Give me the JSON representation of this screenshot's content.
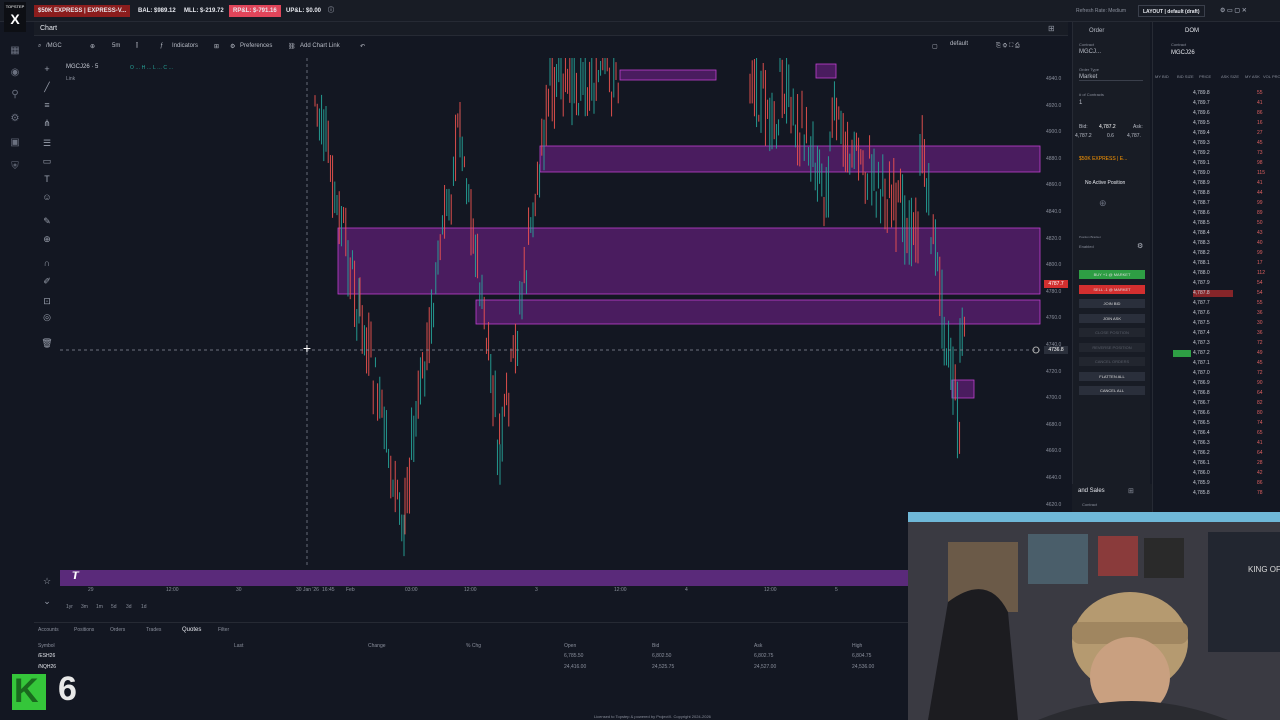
{
  "topbar": {
    "account": "$50K EXPRESS | EXPRESS-V...",
    "bal": "BAL: $989.12",
    "mll": "MLL: $-219.72",
    "rpl": "RP&L: $-791.16",
    "upl": "UP&L: $0.00",
    "refresh": "Refresh Rate: Medium",
    "layout": "LAYOUT | default (draft)"
  },
  "logo": "TOPSTEP",
  "chart_tab": "Chart",
  "toolbar": {
    "symbol": "/MGC",
    "interval": "5m",
    "indicators": "Indicators",
    "preferences": "Preferences",
    "add_chart_link": "Add Chart Link",
    "layout_name": "default",
    "position_bracket": "Position Bracket",
    "bracket_status": "Enabled"
  },
  "chart": {
    "symbol_line": "MGCJ26 · 5",
    "link": "Link",
    "crosshair_price": "4736.8",
    "last_price": "4787.7",
    "price_labels": [
      "4940.0",
      "4920.0",
      "4900.0",
      "4880.0",
      "4860.0",
      "4840.0",
      "4820.0",
      "4800.0",
      "4780.0",
      "4760.0",
      "4740.0",
      "4720.0",
      "4700.0",
      "4680.0",
      "4660.0",
      "4640.0",
      "4620.0"
    ],
    "time_labels": [
      "29",
      "12:00",
      "30",
      "30 Jan '26",
      "16:45",
      "Feb",
      "03:00",
      "12:00",
      "3",
      "12:00",
      "4",
      "12:00",
      "5"
    ],
    "ranges": [
      "1yr",
      "3m",
      "1m",
      "5d",
      "3d",
      "1d"
    ]
  },
  "bottom": {
    "tabs": [
      "Accounts",
      "Positions",
      "Orders",
      "Trades",
      "Quotes",
      "Filter"
    ],
    "active_tab": "Quotes",
    "headers": [
      "Symbol",
      "Last",
      "Change",
      "% Chg",
      "Open",
      "Bid",
      "Ask",
      "High"
    ],
    "rows": [
      [
        "/ESH26",
        "",
        "",
        "",
        "6,785.50",
        "6,802.50",
        "6,802.75",
        "6,804.75"
      ],
      [
        "/NQH26",
        "",
        "",
        "",
        "24,416.00",
        "24,525.75",
        "24,527.00",
        "24,536.00"
      ]
    ],
    "footer": "Licensed to Topstep & powered by ProjectX. Copyright 2024-2026"
  },
  "order": {
    "tabs": [
      "Order",
      "DOM"
    ],
    "contract_label": "Contract",
    "contract": "MGCJ...",
    "order_type_label": "Order Type",
    "order_type": "Market",
    "contracts_label": "# of Contracts",
    "contracts": "1",
    "bid_label": "Bid:",
    "bid": "4,787.2",
    "ask_label": "Ask:",
    "bid_val": "4,787.2",
    "spread": "0.6",
    "ask_val": "4,787.",
    "account": "$50K EXPRESS | E...",
    "no_position": "No Active Position",
    "bracket_label": "Position Bracket",
    "bracket": "Enabled",
    "buttons": [
      "BUY +1 @ MARKET",
      "SELL -1 @ MARKET",
      "JOIN BID",
      "JOIN ASK",
      "CLOSE POSITION",
      "REVERSE POSITION",
      "CANCEL ORDERS",
      "FLATTEN ALL",
      "CANCEL ALL"
    ],
    "ts_tab": "and Sales",
    "ts_contract": "Contract"
  },
  "dom": {
    "contract_label": "Contract",
    "contract": "MGCJ26",
    "headers": [
      "MY BID",
      "BID SIZE",
      "PRICE",
      "ASK SIZE",
      "MY ASK",
      "VOL PRO."
    ],
    "rows": [
      [
        "4,789.8",
        "55"
      ],
      [
        "4,789.7",
        "41"
      ],
      [
        "4,789.6",
        "86"
      ],
      [
        "4,789.5",
        "16"
      ],
      [
        "4,789.4",
        "27"
      ],
      [
        "4,789.3",
        "45"
      ],
      [
        "4,789.2",
        "73"
      ],
      [
        "4,789.1",
        "98"
      ],
      [
        "4,789.0",
        "115"
      ],
      [
        "4,788.9",
        "41"
      ],
      [
        "4,788.8",
        "44"
      ],
      [
        "4,788.7",
        "99"
      ],
      [
        "4,788.6",
        "89"
      ],
      [
        "4,788.5",
        "50"
      ],
      [
        "4,788.4",
        "43"
      ],
      [
        "4,788.3",
        "40"
      ],
      [
        "4,788.2",
        "99"
      ],
      [
        "4,788.1",
        "17"
      ],
      [
        "4,788.0",
        "112"
      ],
      [
        "4,787.9",
        "54"
      ],
      [
        "4,787.8",
        "54"
      ],
      [
        "4,787.7",
        "55"
      ],
      [
        "4,787.6",
        "36"
      ],
      [
        "4,787.5",
        "30"
      ],
      [
        "4,787.4",
        "36"
      ],
      [
        "4,787.3",
        "72"
      ],
      [
        "4,787.2",
        "49"
      ],
      [
        "4,787.1",
        "45"
      ],
      [
        "4,787.0",
        "72"
      ],
      [
        "4,786.9",
        "90"
      ],
      [
        "4,786.8",
        "64"
      ],
      [
        "4,786.7",
        "82"
      ],
      [
        "4,786.6",
        "80"
      ],
      [
        "4,786.5",
        "74"
      ],
      [
        "4,786.4",
        "65"
      ],
      [
        "4,786.3",
        "41"
      ],
      [
        "4,786.2",
        "64"
      ],
      [
        "4,786.1",
        "28"
      ],
      [
        "4,786.0",
        "42"
      ],
      [
        "4,785.9",
        "86"
      ],
      [
        "4,785.8",
        "78"
      ]
    ]
  },
  "badge": "6",
  "colors": {
    "accent": "#9c27b0",
    "zone": "#8e24aa",
    "up": "#26a69a",
    "down": "#ef5350",
    "buy": "#2e9e44",
    "sell": "#d32f2f"
  }
}
